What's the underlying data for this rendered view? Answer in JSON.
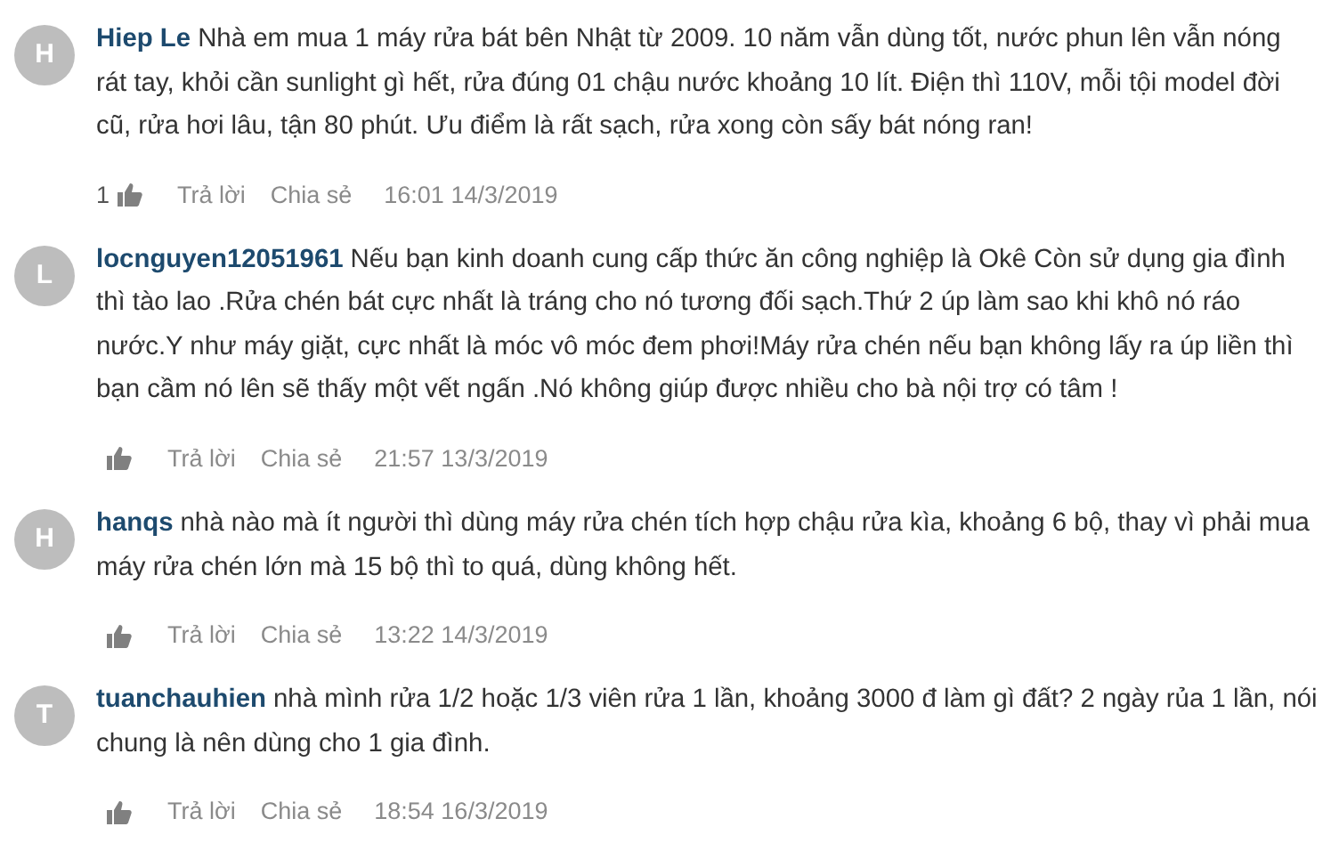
{
  "comments": [
    {
      "avatar": "H",
      "author": "Hiep Le",
      "text": "Nhà em mua 1 máy rửa bát bên Nhật từ 2009. 10 năm vẫn dùng tốt, nước phun lên vẫn nóng rát tay, khỏi cần sunlight gì hết, rửa đúng 01 chậu nước khoảng 10 lít. Điện thì 110V, mỗi tội model đời cũ, rửa hơi lâu, tận 80 phút. Ưu điểm là rất sạch, rửa xong còn sấy bát nóng ran!",
      "likes": "1",
      "reply": "Trả lời",
      "share": "Chia sẻ",
      "time": "16:01 14/3/2019"
    },
    {
      "avatar": "L",
      "author": "locnguyen12051961",
      "text": "Nếu bạn kinh doanh cung cấp thức ăn công nghiệp là Okê Còn sử dụng gia đình thì tào lao .Rửa chén bát cực nhất là tráng cho nó tương đối sạch.Thứ 2 úp làm sao khi khô nó ráo nước.Y như máy giặt, cực nhất là móc vô móc đem phơi!Máy rửa chén nếu bạn không lấy ra úp liền thì bạn cầm nó lên sẽ thấy một vết ngấn .Nó không giúp được nhiều cho bà nội trợ có tâm !",
      "reply": "Trả lời",
      "share": "Chia sẻ",
      "time": "21:57 13/3/2019"
    },
    {
      "avatar": "H",
      "author": "hanqs",
      "text": "nhà nào mà ít người thì dùng máy rửa chén tích hợp chậu rửa kìa, khoảng 6 bộ, thay vì phải mua máy rửa chén lớn mà 15 bộ thì to quá, dùng không hết.",
      "reply": "Trả lời",
      "share": "Chia sẻ",
      "time": "13:22 14/3/2019"
    },
    {
      "avatar": "T",
      "author": "tuanchauhien",
      "text": "nhà mình rửa 1/2 hoặc 1/3 viên rửa 1 lần, khoảng 3000 đ làm gì đất? 2 ngày rủa 1 lần, nói chung là nên dùng cho 1 gia đình.",
      "reply": "Trả lời",
      "share": "Chia sẻ",
      "time": "18:54 16/3/2019"
    }
  ]
}
